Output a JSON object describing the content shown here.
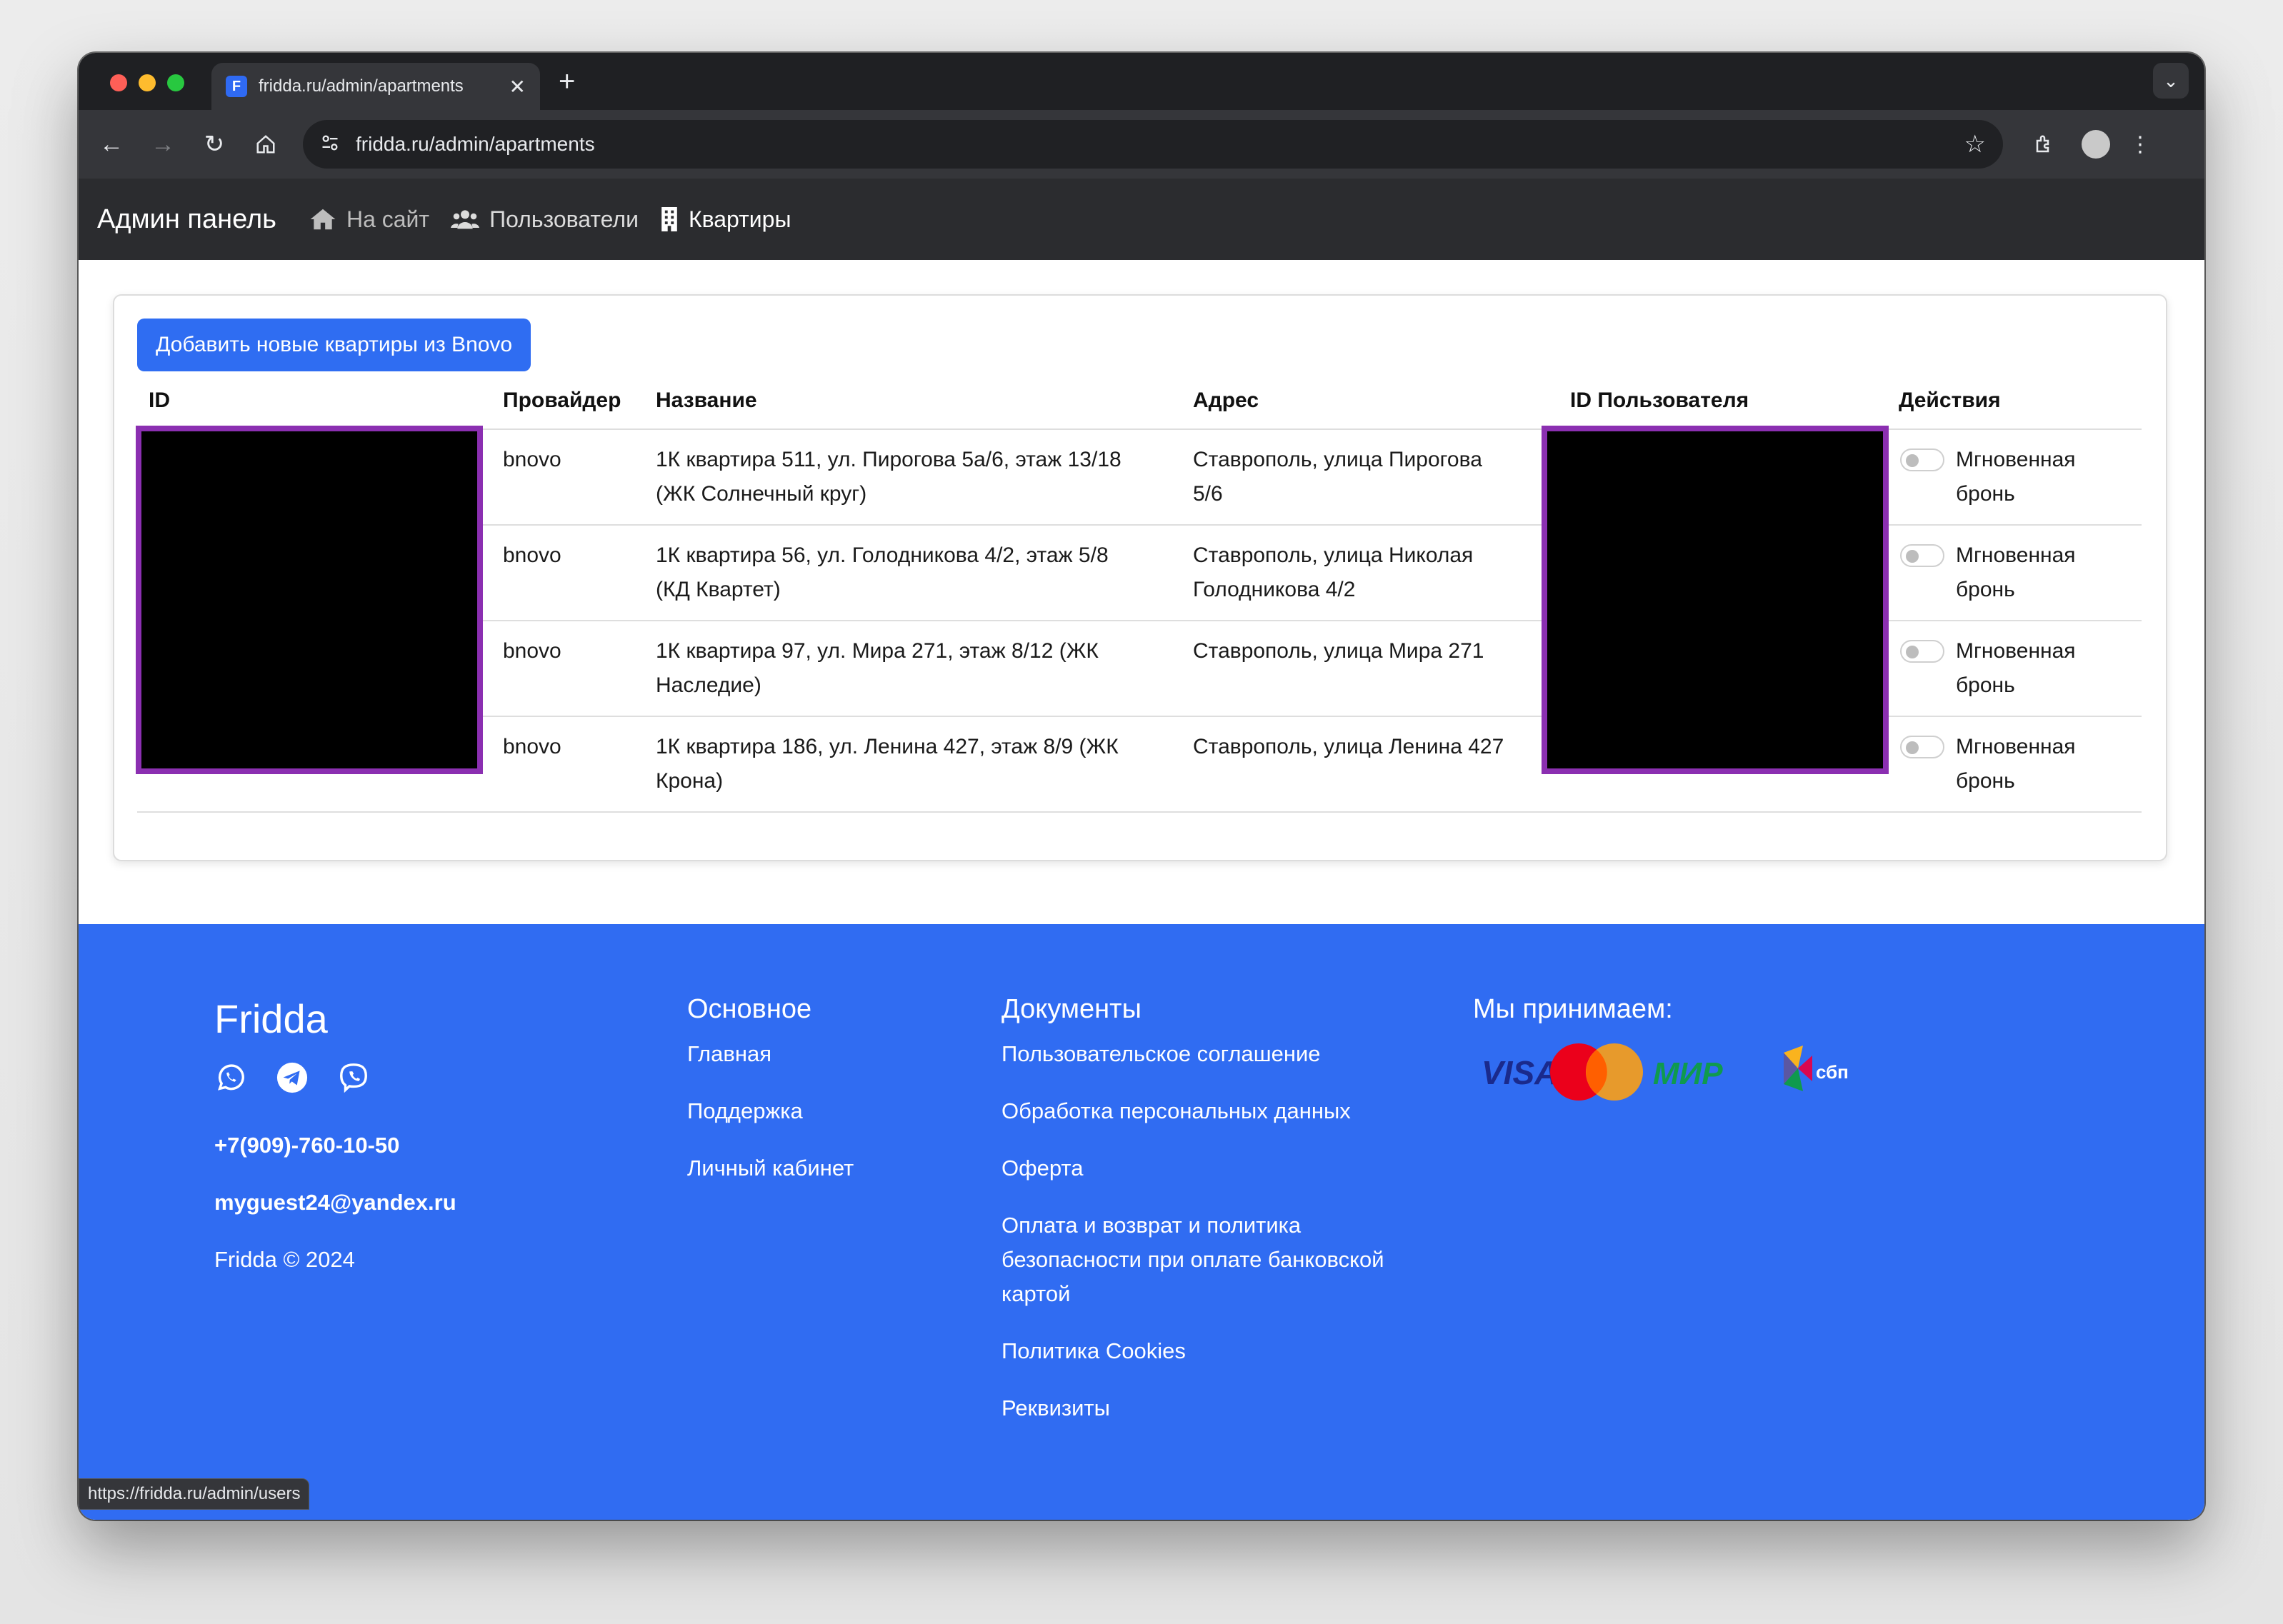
{
  "browser": {
    "tab_title": "fridda.ru/admin/apartments",
    "favicon_letter": "F",
    "address": "fridda.ru/admin/apartments",
    "status_url": "https://fridda.ru/admin/users"
  },
  "nav": {
    "brand": "Админ панель",
    "links": [
      {
        "label": "На сайт",
        "icon": "home-icon",
        "active": false
      },
      {
        "label": "Пользователи",
        "icon": "users-icon",
        "active": false
      },
      {
        "label": "Квартиры",
        "icon": "building-icon",
        "active": true
      }
    ]
  },
  "main": {
    "add_button": "Добавить новые квартиры из Bnovo",
    "columns": [
      "ID",
      "Провайдер",
      "Название",
      "Адрес",
      "ID Пользователя",
      "Действия"
    ],
    "rows": [
      {
        "provider": "bnovo",
        "name_l1": "1К квартира 511, ул. Пирогова 5а/6, этаж 13/18",
        "name_l2": "(ЖК Солнечный круг)",
        "addr_l1": "Ставрополь, улица Пирогова",
        "addr_l2": "5/6",
        "action_l1": "Мгновенная",
        "action_l2": "бронь"
      },
      {
        "provider": "bnovo",
        "name_l1": "1К квартира 56, ул. Голодникова 4/2, этаж 5/8",
        "name_l2": "(КД Квартет)",
        "addr_l1": "Ставрополь, улица Николая",
        "addr_l2": "Голодникова 4/2",
        "action_l1": "Мгновенная",
        "action_l2": "бронь"
      },
      {
        "provider": "bnovo",
        "name_l1": "1К квартира 97, ул. Мира 271, этаж 8/12 (ЖК",
        "name_l2": "Наследие)",
        "addr_l1": "Ставрополь, улица Мира 271",
        "addr_l2": "",
        "action_l1": "Мгновенная",
        "action_l2": "бронь"
      },
      {
        "provider": "bnovo",
        "name_l1": "1К квартира 186, ул. Ленина 427, этаж 8/9 (ЖК",
        "name_l2": "Крона)",
        "addr_l1": "Ставрополь, улица Ленина 427",
        "addr_l2": "",
        "action_l1": "Мгновенная",
        "action_l2": "бронь"
      }
    ]
  },
  "footer": {
    "brand": "Fridda",
    "phone": "+7(909)-760-10-50",
    "email": "myguest24@yandex.ru",
    "copyright": "Fridda © 2024",
    "main_heading": "Основное",
    "main_links": [
      "Главная",
      "Поддержка",
      "Личный кабинет"
    ],
    "docs_heading": "Документы",
    "docs_links": [
      "Пользовательское соглашение",
      "Обработка персональных данных",
      "Оферта",
      "Оплата и возврат и политика",
      "безопасности при оплате банковской",
      "картой",
      "Политика Cookies",
      "Реквизиты"
    ],
    "pay_heading": "Мы принимаем:",
    "pay_logos": {
      "visa": "VISA",
      "mir": "МИР",
      "sbp": "сбп"
    }
  },
  "colors": {
    "accent": "#306cf2",
    "navbar": "#2b2c2f",
    "redaction_border": "#8b2fb1"
  }
}
